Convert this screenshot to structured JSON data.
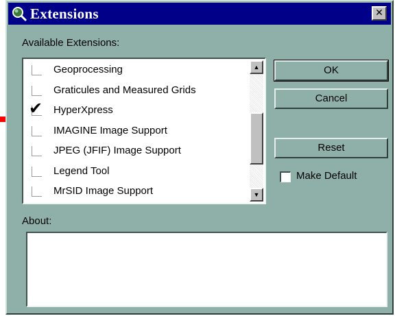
{
  "window": {
    "title": "Extensions",
    "close_glyph": "✕"
  },
  "extensions": {
    "label": "Available Extensions:",
    "items": [
      {
        "label": "Geoprocessing",
        "checked": false
      },
      {
        "label": "Graticules and Measured Grids",
        "checked": false
      },
      {
        "label": "HyperXpress",
        "checked": true
      },
      {
        "label": "IMAGINE Image Support",
        "checked": false
      },
      {
        "label": "JPEG (JFIF) Image Support",
        "checked": false
      },
      {
        "label": "Legend Tool",
        "checked": false
      },
      {
        "label": "MrSID Image Support",
        "checked": false
      }
    ],
    "check_glyph": "✔"
  },
  "buttons": {
    "ok": "OK",
    "cancel": "Cancel",
    "reset": "Reset"
  },
  "make_default": {
    "label": "Make Default",
    "checked": false
  },
  "about": {
    "label": "About:",
    "text": ""
  },
  "colors": {
    "dialog_bg": "#8fb0a8",
    "titlebar": "#000088",
    "arrow": "#ff0000"
  }
}
